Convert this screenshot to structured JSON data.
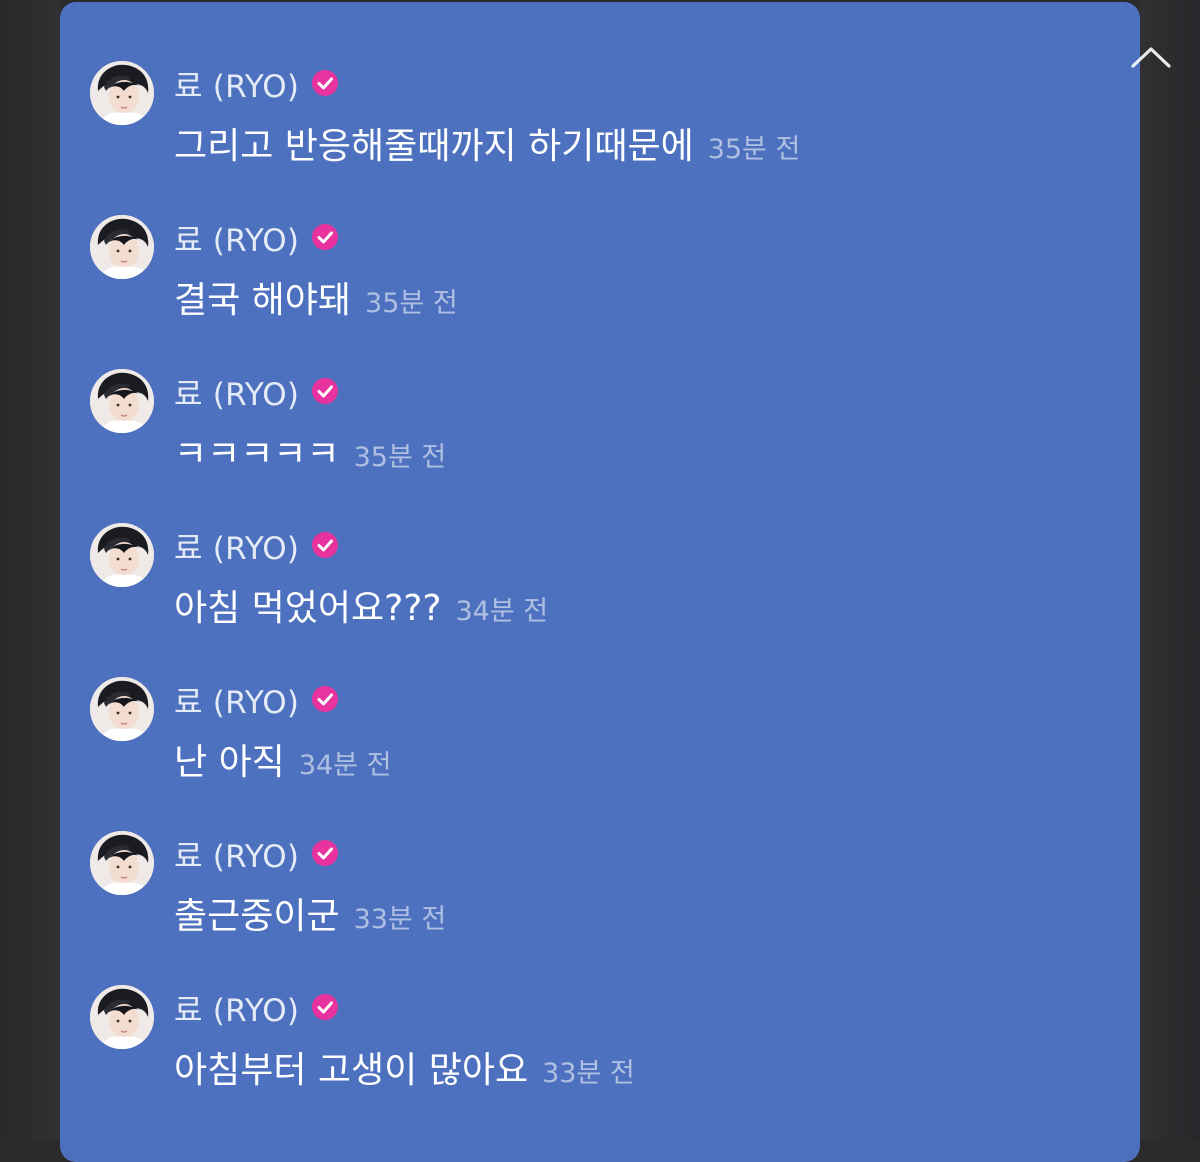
{
  "panel": {
    "collapse_icon": "chevron-up-icon"
  },
  "messages": [
    {
      "author": "료 (RYO)",
      "verified": true,
      "text": "그리고 반응해줄때까지 하기때문에",
      "time": "35분 전"
    },
    {
      "author": "료 (RYO)",
      "verified": true,
      "text": "결국 해야돼",
      "time": "35분 전"
    },
    {
      "author": "료 (RYO)",
      "verified": true,
      "text": "ㅋㅋㅋㅋㅋ",
      "time": "35분 전"
    },
    {
      "author": "료 (RYO)",
      "verified": true,
      "text": "아침 먹었어요???",
      "time": "34분 전"
    },
    {
      "author": "료 (RYO)",
      "verified": true,
      "text": "난 아직",
      "time": "34분 전"
    },
    {
      "author": "료 (RYO)",
      "verified": true,
      "text": "출근중이군",
      "time": "33분 전"
    },
    {
      "author": "료 (RYO)",
      "verified": true,
      "text": "아침부터 고생이 많아요",
      "time": "33분 전"
    }
  ],
  "colors": {
    "panel_bg": "#4d71bf",
    "verified_badge": "#e8329d",
    "page_bg": "#2b2b2e"
  }
}
